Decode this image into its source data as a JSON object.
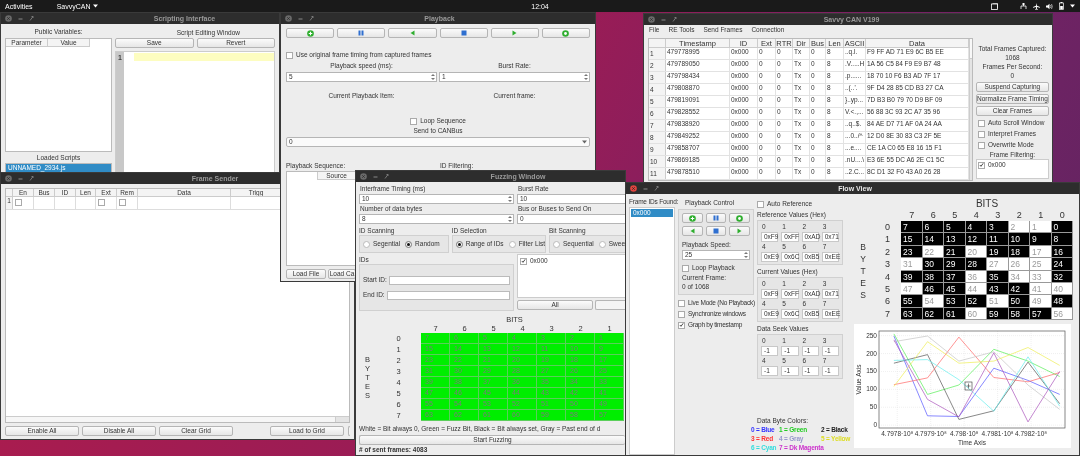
{
  "top_bar": {
    "activities": "Activities",
    "app": "SavvyCAN",
    "clock": "12:04"
  },
  "scripting_window": {
    "title": "Scripting Interface",
    "active": false,
    "public_variables_label": "Public Variables:",
    "columns": [
      "Parameter",
      "Value"
    ],
    "loaded_scripts_label": "Loaded Scripts",
    "scripts": [
      {
        "name": "UNNAMED_2934.js",
        "selected": true
      }
    ],
    "editor_label": "Script Editing Window",
    "buttons": [
      "Save",
      "Revert"
    ],
    "line_numbers": [
      "1"
    ]
  },
  "frame_sender": {
    "title": "Frame Sender",
    "active": false,
    "columns": [
      "En",
      "Bus",
      "ID",
      "Len",
      "Ext",
      "Rem",
      "Data",
      "Trigg"
    ],
    "rows": [
      {
        "number": "1",
        "enabled": false,
        "ext": false,
        "rem": false
      }
    ],
    "buttons": [
      "Enable All",
      "Disable All",
      "Clear Grid",
      "Load to Grid"
    ]
  },
  "playback_window": {
    "title": "Playback",
    "active": false,
    "use_original_timing": {
      "label": "Use original frame timing from captured frames",
      "checked": false
    },
    "speed_label": "Playback speed (ms):",
    "speed": "5",
    "burst_label": "Burst Rate:",
    "burst": "1",
    "current_item_label": "Current Playback Item:",
    "current_frame_label": "Current frame:",
    "loop": {
      "label": "Loop Sequence",
      "checked": false
    },
    "send_label": "Send to CANBus",
    "bus": "0",
    "sequence_label": "Playback Sequence:",
    "id_filter_label": "ID Filtering:",
    "sequence_columns": [
      "Source"
    ],
    "buttons": [
      "Load File",
      "Load Ca"
    ]
  },
  "savvycan_window": {
    "title": "Savvy CAN V199",
    "active": false,
    "menu": [
      "File",
      "RE Tools",
      "Send Frames",
      "Connection"
    ],
    "columns": [
      "Timestamp",
      "ID",
      "Ext",
      "RTR",
      "Dir",
      "Bus",
      "Len",
      "ASCII",
      "Data"
    ],
    "rows": [
      {
        "number": "1",
        "cells": [
          "479778995",
          "0x000",
          "0",
          "0",
          "Tx",
          "0",
          "8",
          "..q.l.",
          "F9 FF AD 71 E9 6C B5 EE"
        ]
      },
      {
        "number": "2",
        "cells": [
          "479789050",
          "0x000",
          "0",
          "0",
          "Tx",
          "0",
          "8",
          ".V.....H",
          "1A 56 C5 84 F9 E9 B7 48"
        ]
      },
      {
        "number": "3",
        "cells": [
          "479798434",
          "0x000",
          "0",
          "0",
          "Tx",
          "0",
          "8",
          ".p......",
          "18 70 10 F6 B3 AD 7F 17"
        ]
      },
      {
        "number": "4",
        "cells": [
          "479808870",
          "0x000",
          "0",
          "0",
          "Tx",
          "0",
          "8",
          "..(..'.",
          "9F D4 28 85 CD B3 27 CA"
        ]
      },
      {
        "number": "5",
        "cells": [
          "479819091",
          "0x000",
          "0",
          "0",
          "Tx",
          "0",
          "8",
          "}..yp...",
          "7D B3 B0 79 70 D9 BF 09"
        ]
      },
      {
        "number": "6",
        "cells": [
          "479828552",
          "0x000",
          "0",
          "0",
          "Tx",
          "0",
          "8",
          "V.<.,...",
          "56 88 3C 93 2C A7 35 96"
        ]
      },
      {
        "number": "7",
        "cells": [
          "479838920",
          "0x000",
          "0",
          "0",
          "Tx",
          "0",
          "8",
          "..q..$.",
          "84 AE D7 71 AF 0A 24 AA"
        ]
      },
      {
        "number": "8",
        "cells": [
          "479849252",
          "0x000",
          "0",
          "0",
          "Tx",
          "0",
          "8",
          "...0../^",
          "12 D0 8E 30 83 C3 2F 5E"
        ]
      },
      {
        "number": "9",
        "cells": [
          "479858707",
          "0x000",
          "0",
          "0",
          "Tx",
          "0",
          "8",
          "...e....",
          "CE 1A C0 65 E8 16 15 F1"
        ]
      },
      {
        "number": "10",
        "cells": [
          "479869185",
          "0x000",
          "0",
          "0",
          "Tx",
          "0",
          "8",
          ".nU....\\",
          "E3 6E 55 DC A6 2E C1 5C"
        ]
      },
      {
        "number": "11",
        "cells": [
          "479878510",
          "0x000",
          "0",
          "0",
          "Tx",
          "0",
          "8",
          "..2.C...",
          "8C D1 32 F0 43 A0 26 28"
        ]
      }
    ],
    "total_label": "Total Frames Captured:",
    "total": "1068",
    "fps_label": "Frames Per Second:",
    "fps": "0",
    "buttons": [
      "Suspend Capturing",
      "Normalize Frame Timing",
      "Clear Frames"
    ],
    "options": [
      {
        "label": "Auto Scroll Window",
        "checked": false
      },
      {
        "label": "Interpret Frames",
        "checked": false
      },
      {
        "label": "Overwrite Mode",
        "checked": false
      }
    ],
    "filter_label": "Frame Filtering:",
    "filters": [
      {
        "label": "0x000",
        "checked": true
      }
    ]
  },
  "fuzzing_window": {
    "title": "Fuzzing Window",
    "active": false,
    "fields": [
      {
        "label": "Interframe Timing (ms)",
        "value": "10"
      },
      {
        "label": "Burst Rate",
        "value": "10"
      },
      {
        "label": "Number of data bytes",
        "value": "8"
      },
      {
        "label": "Bus or Buses to Send On",
        "value": "0"
      }
    ],
    "groups": [
      {
        "title": "ID Scanning",
        "options": [
          {
            "label": "Segential",
            "selected": false
          },
          {
            "label": "Random",
            "selected": true
          }
        ]
      },
      {
        "title": "ID Selection",
        "options": [
          {
            "label": "Range of IDs",
            "selected": true
          },
          {
            "label": "Filter List",
            "selected": false
          }
        ]
      },
      {
        "title": "Bit Scanning",
        "options": [
          {
            "label": "Sequential",
            "selected": false
          },
          {
            "label": "Swee",
            "selected": false
          }
        ]
      }
    ],
    "ids_label": "IDs",
    "start_label": "Start ID:",
    "end_label": "End ID:",
    "id_list": [
      {
        "label": "0x000",
        "checked": true
      }
    ],
    "all_button": "All",
    "bits_label": "BITS",
    "bytes_label": "BYTES",
    "bit_columns": [
      "7",
      "6",
      "5",
      "4",
      "3",
      "2",
      "1"
    ],
    "rows": [
      {
        "label": "0",
        "cells": [
          {
            "text": "7",
            "fuzz": true
          },
          {
            "text": "6",
            "fuzz": true
          },
          {
            "text": "5",
            "fuzz": true
          },
          {
            "text": "4",
            "fuzz": true
          },
          {
            "text": "3",
            "fuzz": true
          },
          {
            "text": "2",
            "fuzz": true
          },
          {
            "text": "1",
            "fuzz": true
          }
        ]
      },
      {
        "label": "1",
        "cells": [
          {
            "text": "15",
            "fuzz": true
          },
          {
            "text": "14",
            "fuzz": true
          },
          {
            "text": "13",
            "fuzz": true
          },
          {
            "text": "12",
            "fuzz": true
          },
          {
            "text": "11",
            "fuzz": true
          },
          {
            "text": "10",
            "fuzz": true
          },
          {
            "text": "9",
            "fuzz": true
          }
        ]
      },
      {
        "label": "2",
        "cells": [
          {
            "text": "23",
            "fuzz": true
          },
          {
            "text": "22",
            "fuzz": true
          },
          {
            "text": "21",
            "fuzz": true
          },
          {
            "text": "20",
            "fuzz": true
          },
          {
            "text": "19",
            "fuzz": true
          },
          {
            "text": "18",
            "fuzz": true
          },
          {
            "text": "17",
            "fuzz": true
          }
        ]
      },
      {
        "label": "3",
        "cells": [
          {
            "text": "31",
            "fuzz": true
          },
          {
            "text": "30",
            "fuzz": true
          },
          {
            "text": "29",
            "fuzz": true
          },
          {
            "text": "28",
            "fuzz": true
          },
          {
            "text": "27",
            "fuzz": true
          },
          {
            "text": "26",
            "fuzz": true
          },
          {
            "text": "25",
            "fuzz": true
          }
        ]
      },
      {
        "label": "4",
        "cells": [
          {
            "text": "39",
            "fuzz": true
          },
          {
            "text": "38",
            "fuzz": true
          },
          {
            "text": "37",
            "fuzz": true
          },
          {
            "text": "36",
            "fuzz": true
          },
          {
            "text": "35",
            "fuzz": true
          },
          {
            "text": "34",
            "fuzz": true
          },
          {
            "text": "33",
            "fuzz": true
          }
        ]
      },
      {
        "label": "5",
        "cells": [
          {
            "text": "47",
            "fuzz": true
          },
          {
            "text": "46",
            "fuzz": true
          },
          {
            "text": "45",
            "fuzz": true
          },
          {
            "text": "44",
            "fuzz": true
          },
          {
            "text": "43",
            "fuzz": true
          },
          {
            "text": "42",
            "fuzz": true
          },
          {
            "text": "41",
            "fuzz": true
          }
        ]
      },
      {
        "label": "6",
        "cells": [
          {
            "text": "55",
            "fuzz": true
          },
          {
            "text": "54",
            "fuzz": true
          },
          {
            "text": "53",
            "fuzz": true
          },
          {
            "text": "52",
            "fuzz": true
          },
          {
            "text": "51",
            "fuzz": true
          },
          {
            "text": "50",
            "fuzz": true
          },
          {
            "text": "49",
            "fuzz": true
          }
        ]
      },
      {
        "label": "7",
        "cells": [
          {
            "text": "63",
            "fuzz": true
          },
          {
            "text": "62",
            "fuzz": true
          },
          {
            "text": "61",
            "fuzz": true
          },
          {
            "text": "60",
            "fuzz": true
          },
          {
            "text": "59",
            "fuzz": true
          },
          {
            "text": "58",
            "fuzz": true
          },
          {
            "text": "57",
            "fuzz": true
          }
        ]
      }
    ],
    "legend": "White = Bit always 0, Green = Fuzz Bit, Black = Bit always set, Gray = Past end of d",
    "start_button": "Start Fuzzing",
    "sent_frames": "# of sent frames: 4083"
  },
  "flow_view": {
    "title": "Flow View",
    "active": true,
    "ids_label": "Frame IDs Found:",
    "ids": [
      {
        "label": "0x000",
        "selected": true
      }
    ],
    "playback_label": "Playback Control",
    "speed_label": "Playback Speed:",
    "speed": "25",
    "loop": {
      "label": "Loop Playback",
      "checked": false
    },
    "current_frame_label": "Current Frame:",
    "current_frame": "0 of 1068",
    "options": [
      {
        "label": "Live Mode (No Playback)",
        "checked": false
      },
      {
        "label": "Synchronize windows",
        "checked": false
      },
      {
        "label": "Graph by timestamp",
        "checked": true
      }
    ],
    "auto_reference": {
      "label": "Auto Reference",
      "checked": false
    },
    "value_groups": [
      {
        "title": "Reference Values (Hex)",
        "cells": [
          {
            "index": "0",
            "value": "0xF9"
          },
          {
            "index": "1",
            "value": "0xFF"
          },
          {
            "index": "2",
            "value": "0xAD"
          },
          {
            "index": "3",
            "value": "0x71"
          },
          {
            "index": "4",
            "value": "0xE9"
          },
          {
            "index": "5",
            "value": "0x6C"
          },
          {
            "index": "6",
            "value": "0xB5"
          },
          {
            "index": "7",
            "value": "0xEE"
          }
        ]
      },
      {
        "title": "Current Values (Hex)",
        "cells": [
          {
            "index": "0",
            "value": "0xF9"
          },
          {
            "index": "1",
            "value": "0xFF"
          },
          {
            "index": "2",
            "value": "0xAD"
          },
          {
            "index": "3",
            "value": "0x71"
          },
          {
            "index": "4",
            "value": "0xE9"
          },
          {
            "index": "5",
            "value": "0x6C"
          },
          {
            "index": "6",
            "value": "0xB5"
          },
          {
            "index": "7",
            "value": "0xEE"
          }
        ]
      },
      {
        "title": "Data Seek Values",
        "cells": [
          {
            "index": "0",
            "value": "-1"
          },
          {
            "index": "1",
            "value": "-1"
          },
          {
            "index": "2",
            "value": "-1"
          },
          {
            "index": "3",
            "value": "-1"
          },
          {
            "index": "4",
            "value": "-1"
          },
          {
            "index": "5",
            "value": "-1"
          },
          {
            "index": "6",
            "value": "-1"
          },
          {
            "index": "7",
            "value": "-1"
          }
        ]
      }
    ],
    "colors_label": "Data Byte Colors:",
    "colors": [
      {
        "label": "0 = Blue",
        "color": "#3333ff"
      },
      {
        "label": "1 = Green",
        "color": "#22cc22"
      },
      {
        "label": "2 = Black",
        "color": "#222222"
      },
      {
        "label": "3 = Red",
        "color": "#ff3333"
      },
      {
        "label": "4 = Gray",
        "color": "#9999cc"
      },
      {
        "label": "5 = Yellow",
        "color": "#dddd22"
      },
      {
        "label": "6 = Cyan",
        "color": "#33dddd"
      },
      {
        "label": "7 = Dk Magenta",
        "color": "#cc33cc"
      }
    ],
    "bits_label": "BITS",
    "bytes_label": "BYTES",
    "bit_columns": [
      "7",
      "6",
      "5",
      "4",
      "3",
      "2",
      "1",
      "0"
    ],
    "rows": [
      {
        "label": "0",
        "cells": [
          {
            "text": "7",
            "on": true
          },
          {
            "text": "6",
            "on": true
          },
          {
            "text": "5",
            "on": true
          },
          {
            "text": "4",
            "on": true
          },
          {
            "text": "3",
            "on": true
          },
          {
            "text": "2",
            "on": false
          },
          {
            "text": "1",
            "on": false
          },
          {
            "text": "0",
            "on": true
          }
        ]
      },
      {
        "label": "1",
        "cells": [
          {
            "text": "15",
            "on": true
          },
          {
            "text": "14",
            "on": true
          },
          {
            "text": "13",
            "on": true
          },
          {
            "text": "12",
            "on": true
          },
          {
            "text": "11",
            "on": true
          },
          {
            "text": "10",
            "on": true
          },
          {
            "text": "9",
            "on": true
          },
          {
            "text": "8",
            "on": true
          }
        ]
      },
      {
        "label": "2",
        "cells": [
          {
            "text": "23",
            "on": true
          },
          {
            "text": "22",
            "on": false
          },
          {
            "text": "21",
            "on": true
          },
          {
            "text": "20",
            "on": false
          },
          {
            "text": "19",
            "on": true
          },
          {
            "text": "18",
            "on": true
          },
          {
            "text": "17",
            "on": false
          },
          {
            "text": "16",
            "on": true
          }
        ]
      },
      {
        "label": "3",
        "cells": [
          {
            "text": "31",
            "on": false
          },
          {
            "text": "30",
            "on": true
          },
          {
            "text": "29",
            "on": true
          },
          {
            "text": "28",
            "on": true
          },
          {
            "text": "27",
            "on": false
          },
          {
            "text": "26",
            "on": false
          },
          {
            "text": "25",
            "on": false
          },
          {
            "text": "24",
            "on": true
          }
        ]
      },
      {
        "label": "4",
        "cells": [
          {
            "text": "39",
            "on": true
          },
          {
            "text": "38",
            "on": true
          },
          {
            "text": "37",
            "on": true
          },
          {
            "text": "36",
            "on": false
          },
          {
            "text": "35",
            "on": true
          },
          {
            "text": "34",
            "on": false
          },
          {
            "text": "33",
            "on": false
          },
          {
            "text": "32",
            "on": true
          }
        ]
      },
      {
        "label": "5",
        "cells": [
          {
            "text": "47",
            "on": false
          },
          {
            "text": "46",
            "on": true
          },
          {
            "text": "45",
            "on": true
          },
          {
            "text": "44",
            "on": false
          },
          {
            "text": "43",
            "on": true
          },
          {
            "text": "42",
            "on": true
          },
          {
            "text": "41",
            "on": false
          },
          {
            "text": "40",
            "on": false
          }
        ]
      },
      {
        "label": "6",
        "cells": [
          {
            "text": "55",
            "on": true
          },
          {
            "text": "54",
            "on": false
          },
          {
            "text": "53",
            "on": true
          },
          {
            "text": "52",
            "on": true
          },
          {
            "text": "51",
            "on": false
          },
          {
            "text": "50",
            "on": true
          },
          {
            "text": "49",
            "on": false
          },
          {
            "text": "48",
            "on": true
          }
        ]
      },
      {
        "label": "7",
        "cells": [
          {
            "text": "63",
            "on": true
          },
          {
            "text": "62",
            "on": true
          },
          {
            "text": "61",
            "on": true
          },
          {
            "text": "60",
            "on": false
          },
          {
            "text": "59",
            "on": true
          },
          {
            "text": "58",
            "on": true
          },
          {
            "text": "57",
            "on": true
          },
          {
            "text": "56",
            "on": false
          }
        ]
      }
    ],
    "chart_data": {
      "type": "line",
      "xlabel": "Time Axis",
      "ylabel": "Value Axis",
      "x": [
        479778995,
        479789050,
        479798434,
        479808870,
        479819091,
        479828552
      ],
      "series": [
        {
          "color": "#5555ff",
          "values": [
            249,
            26,
            24,
            159,
            125,
            86
          ]
        },
        {
          "color": "#55ee55",
          "values": [
            255,
            86,
            112,
            212,
            179,
            136
          ]
        },
        {
          "color": "#555555",
          "values": [
            173,
            197,
            16,
            40,
            176,
            60
          ]
        },
        {
          "color": "#ff6666",
          "values": [
            113,
            132,
            246,
            133,
            121,
            147
          ]
        },
        {
          "color": "#c4c4c4",
          "values": [
            233,
            249,
            179,
            205,
            112,
            44
          ]
        },
        {
          "color": "#eeee55",
          "values": [
            108,
            233,
            173,
            179,
            217,
            167
          ]
        },
        {
          "color": "#66eeee",
          "values": [
            181,
            183,
            127,
            39,
            191,
            53
          ]
        },
        {
          "color": "#aa55bb",
          "values": [
            238,
            72,
            23,
            202,
            9,
            150
          ]
        }
      ],
      "xlim": [
        479774550,
        479830136
      ],
      "ylim": [
        -8,
        263
      ],
      "xticks": [
        {
          "value": 479780000,
          "label": "4.7978·10⁸"
        },
        {
          "value": 479790000,
          "label": "4.7979·10⁸"
        },
        {
          "value": 479800000,
          "label": "4.798·10⁸"
        },
        {
          "value": 479810000,
          "label": "4.7981·10⁸"
        },
        {
          "value": 479820000,
          "label": "4.7982·10⁸"
        }
      ],
      "yticks": [
        0,
        50,
        100,
        150,
        200,
        250
      ],
      "grid": true
    }
  }
}
